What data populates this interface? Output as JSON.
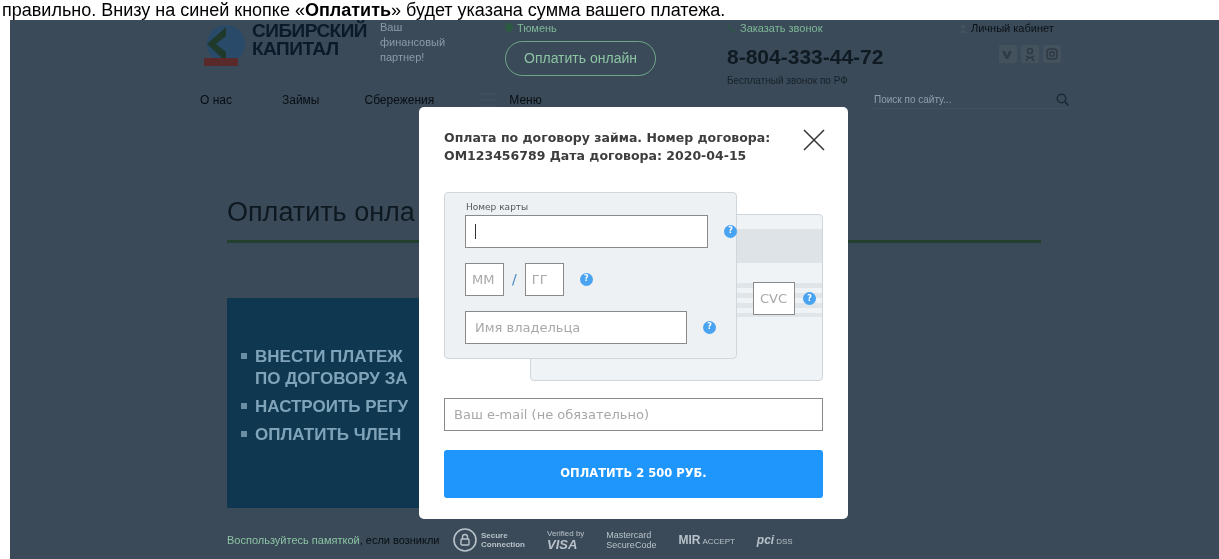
{
  "caption": "правильно. Внизу на синей кнопке «**Оплатить**» будет указана сумма вашего платежа.",
  "header": {
    "logo": {
      "line1": "СИБИРСКИЙ",
      "line2": "КАПИТАЛ"
    },
    "tagline": [
      "Ваш",
      "финансовый",
      "партнер!"
    ],
    "city": "Тюмень",
    "pay_online": "Оплатить онлайн",
    "callback": "Заказать звонок",
    "phone": "8-804-333-44-72",
    "phone_note": "Бесплатный звонок по РФ",
    "cabinet": "Личный кабинет",
    "socials": [
      {
        "kind": "vk"
      },
      {
        "kind": "ok"
      },
      {
        "kind": "instagram"
      }
    ]
  },
  "nav": {
    "items": [
      "О нас",
      "Займы",
      "Сбережения"
    ],
    "menu": "Меню",
    "search_placeholder": "Поиск по сайту..."
  },
  "page": {
    "heading": "Оплатить онла",
    "banner_bullets": [
      [
        "ВНЕСТИ ПЛАТЕЖ",
        "ПО ДОГОВОРУ ЗА"
      ],
      [
        "НАСТРОИТЬ РЕГУ"
      ],
      [
        "ОПЛАТИТЬ ЧЛЕН"
      ]
    ],
    "note": {
      "link": "Воспользуйтесь памяткой",
      "rest": ", если возникли"
    }
  },
  "modal": {
    "title": "Оплата по договору займа. Номер договора: OM123456789 Дата договора: 2020-04-15",
    "card_number": {
      "label": "Номер карты",
      "focused": true,
      "help": "?"
    },
    "expiry": {
      "month_placeholder": "ММ",
      "separator": "/",
      "year_placeholder": "ГГ",
      "help": "?"
    },
    "holder": {
      "placeholder": "Имя владельца",
      "help": "?"
    },
    "cvc": {
      "placeholder": "CVC",
      "help": "?"
    },
    "email": {
      "placeholder": "Ваш e-mail (не обязательно)"
    },
    "pay_button": "ОПЛАТИТЬ 2 500 РУБ."
  },
  "badges": [
    {
      "kind": "secure",
      "lines": [
        "Secure",
        "Connection"
      ]
    },
    {
      "kind": "visa",
      "lines": [
        "Verified by",
        "VISA"
      ]
    },
    {
      "kind": "mastercard",
      "lines": [
        "Mastercard",
        "SecureCode"
      ]
    },
    {
      "kind": "mir",
      "lines": [
        "MIR",
        "ACCEPT"
      ]
    },
    {
      "kind": "pci",
      "lines": [
        "pci",
        "DSS"
      ]
    }
  ]
}
